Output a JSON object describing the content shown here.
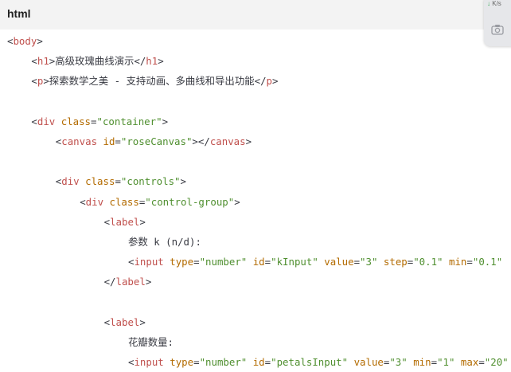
{
  "header": {
    "language": "html"
  },
  "widget": {
    "speed_unit": "K/s",
    "speed_arrow": "↓",
    "camera_icon": "camera-icon"
  },
  "code_lines": [
    [
      "<",
      "body",
      ">"
    ],
    [
      "<",
      "h1",
      ">",
      "高级玫瑰曲线演示",
      "</",
      "h1",
      ">"
    ],
    [
      "<",
      "p",
      ">",
      "探索数学之美 - 支持动画、多曲线和导出功能",
      "</",
      "p",
      ">"
    ],
    [],
    [
      "<",
      "div",
      " ",
      "class",
      "=",
      "\"container\"",
      ">"
    ],
    [
      "<",
      "canvas",
      " ",
      "id",
      "=",
      "\"roseCanvas\"",
      "></",
      "canvas",
      ">"
    ],
    [],
    [
      "<",
      "div",
      " ",
      "class",
      "=",
      "\"controls\"",
      ">"
    ],
    [
      "<",
      "div",
      " ",
      "class",
      "=",
      "\"control-group\"",
      ">"
    ],
    [
      "<",
      "label",
      ">"
    ],
    [
      "参数 k (n/d):"
    ],
    [
      "<",
      "input",
      " ",
      "type",
      "=",
      "\"number\"",
      " ",
      "id",
      "=",
      "\"kInput\"",
      " ",
      "value",
      "=",
      "\"3\"",
      " ",
      "step",
      "=",
      "\"0.1\"",
      " ",
      "min",
      "=",
      "\"0.1\""
    ],
    [
      "</",
      "label",
      ">"
    ],
    [],
    [
      "<",
      "label",
      ">"
    ],
    [
      "花瓣数量:"
    ],
    [
      "<",
      "input",
      " ",
      "type",
      "=",
      "\"number\"",
      " ",
      "id",
      "=",
      "\"petalsInput\"",
      " ",
      "value",
      "=",
      "\"3\"",
      " ",
      "min",
      "=",
      "\"1\"",
      " ",
      "max",
      "=",
      "\"20\""
    ]
  ]
}
